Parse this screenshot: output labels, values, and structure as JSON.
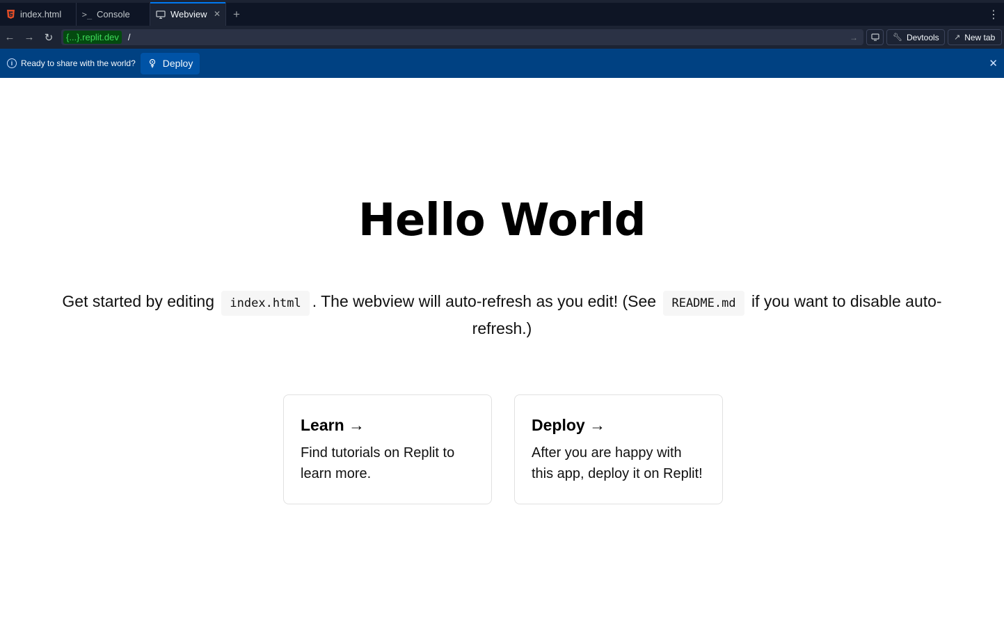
{
  "tabs": [
    {
      "label": "index.html",
      "icon": "html5-icon"
    },
    {
      "label": "Console",
      "icon": "terminal-icon"
    },
    {
      "label": "Webview",
      "icon": "monitor-icon",
      "active": true
    }
  ],
  "address": {
    "host": "{...}.replit.dev",
    "path": "/"
  },
  "toolbar": {
    "devtools_label": "Devtools",
    "newtab_label": "New tab"
  },
  "banner": {
    "text": "Ready to share with the world?",
    "deploy_label": "Deploy"
  },
  "page": {
    "title": "Hello World",
    "desc_part1": "Get started by editing",
    "code1": "index.html",
    "desc_part2": ". The webview will auto-refresh as you edit! (See",
    "code2": "README.md",
    "desc_part3": "if you want to disable auto-refresh.)",
    "cards": [
      {
        "title": "Learn →",
        "text": "Find tutorials on Replit to learn more."
      },
      {
        "title": "Deploy →",
        "text": "After you are happy with this app, deploy it on Replit!"
      }
    ]
  },
  "colors": {
    "tabbar_bg": "#0e1525",
    "toolbar_bg": "#1c2333",
    "banner_bg": "#004182",
    "accent": "#0079f2",
    "host_text": "#3fdb5a"
  }
}
